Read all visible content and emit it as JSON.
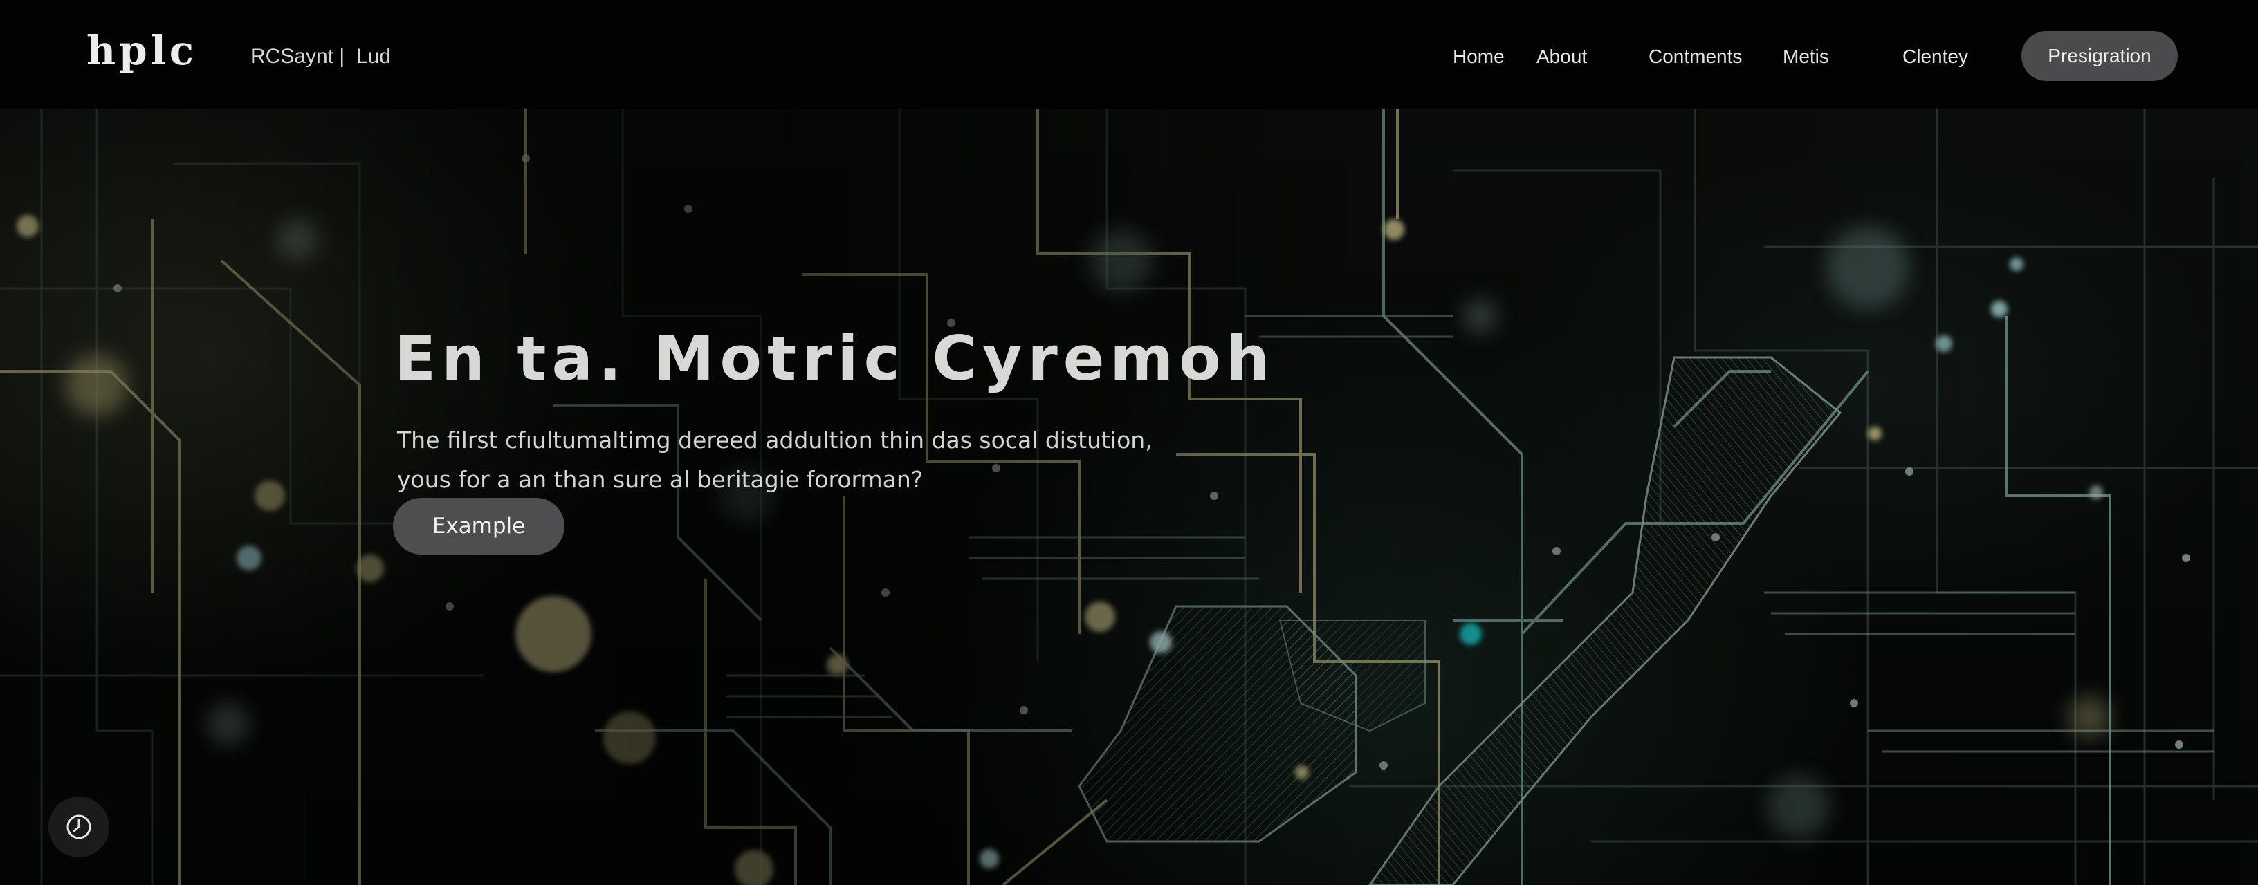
{
  "header": {
    "logo": "hplc",
    "tagline": "RCSaynt |  Lud",
    "nav": [
      {
        "label": "Home"
      },
      {
        "label": "About"
      },
      {
        "label": "Contments"
      },
      {
        "label": "Metis"
      },
      {
        "label": "Clentey"
      }
    ],
    "register_label": "Presigration"
  },
  "hero": {
    "title": "En ta. Motric Cyremoh",
    "text_lines": [
      "The filrst cfıultumaltimg dereed addultion thin das socal distution,",
      "yous for a an than sure al beritagie fororman?"
    ],
    "cta_label": "Example",
    "background": "circuit-board-illustration"
  },
  "floating": {
    "icon": "clock-icon"
  },
  "colors": {
    "nav_bg": "#020202",
    "button_bg": "#4b4b4d",
    "circuit_gold": "#b8b27a",
    "circuit_teal": "#7fb3ab",
    "accent_cyan": "#19b3b0"
  }
}
